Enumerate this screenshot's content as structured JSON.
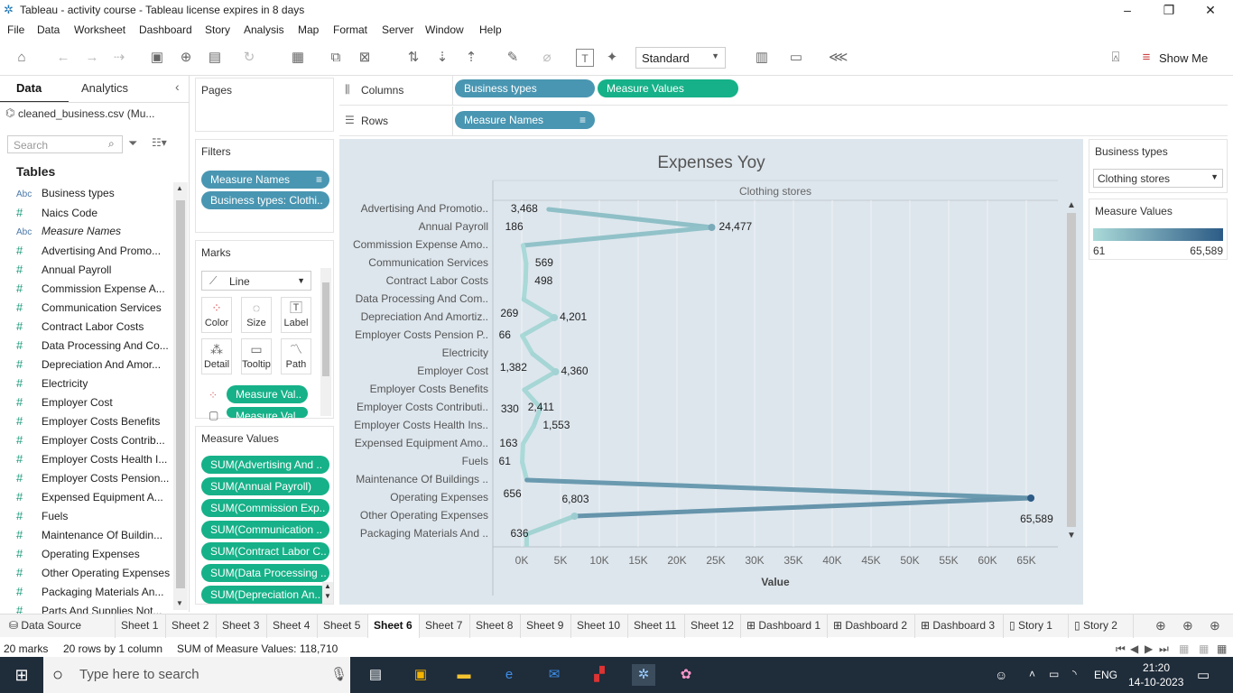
{
  "window": {
    "title": "Tableau - activity course - Tableau license expires in 8 days"
  },
  "menu": [
    "File",
    "Data",
    "Worksheet",
    "Dashboard",
    "Story",
    "Analysis",
    "Map",
    "Format",
    "Server",
    "Window",
    "Help"
  ],
  "toolbar": {
    "standard_label": "Standard",
    "show_me": "Show Me"
  },
  "datapane": {
    "tab_data": "Data",
    "tab_analytics": "Analytics",
    "datasource": "cleaned_business.csv (Mu...",
    "search_placeholder": "Search",
    "tables_heading": "Tables",
    "fields": [
      {
        "type": "Abc",
        "name": "Business types"
      },
      {
        "type": "#",
        "name": "Naics Code"
      },
      {
        "type": "Abc",
        "name": "Measure Names"
      },
      {
        "type": "#",
        "name": "Advertising And Promo..."
      },
      {
        "type": "#",
        "name": "Annual Payroll"
      },
      {
        "type": "#",
        "name": "Commission Expense A..."
      },
      {
        "type": "#",
        "name": "Communication Services"
      },
      {
        "type": "#",
        "name": "Contract Labor Costs"
      },
      {
        "type": "#",
        "name": "Data Processing And Co..."
      },
      {
        "type": "#",
        "name": "Depreciation And Amor..."
      },
      {
        "type": "#",
        "name": "Electricity"
      },
      {
        "type": "#",
        "name": "Employer Cost"
      },
      {
        "type": "#",
        "name": "Employer Costs Benefits"
      },
      {
        "type": "#",
        "name": "Employer Costs Contrib..."
      },
      {
        "type": "#",
        "name": "Employer Costs Health I..."
      },
      {
        "type": "#",
        "name": "Employer Costs Pension..."
      },
      {
        "type": "#",
        "name": "Expensed Equipment A..."
      },
      {
        "type": "#",
        "name": "Fuels"
      },
      {
        "type": "#",
        "name": "Maintenance Of Buildin..."
      },
      {
        "type": "#",
        "name": "Operating Expenses"
      },
      {
        "type": "#",
        "name": "Other Operating Expenses"
      },
      {
        "type": "#",
        "name": "Packaging Materials An..."
      },
      {
        "type": "#",
        "name": "Parts And Supplies Not..."
      }
    ]
  },
  "cards": {
    "pages": "Pages",
    "filters": "Filters",
    "filter_pills": [
      "Measure Names",
      "Business types: Clothi.."
    ],
    "marks": "Marks",
    "mark_type": "Line",
    "mark_buttons": [
      "Color",
      "Size",
      "Label",
      "Detail",
      "Tooltip",
      "Path"
    ],
    "mark_pills": [
      "Measure Val..",
      "Measure Val.."
    ],
    "measure_values": "Measure Values",
    "mv_pills": [
      "SUM(Advertising And ..",
      "SUM(Annual Payroll)",
      "SUM(Commission Exp..",
      "SUM(Communication ..",
      "SUM(Contract Labor C..",
      "SUM(Data Processing ..",
      "SUM(Depreciation An.."
    ]
  },
  "shelves": {
    "columns": "Columns",
    "rows": "Rows",
    "column_pills": [
      "Business types",
      "Measure Values"
    ],
    "row_pills": [
      "Measure Names"
    ]
  },
  "chart_data": {
    "type": "line",
    "title": "Expenses Yoy",
    "column_header": "Clothing stores",
    "xlabel": "Value",
    "xlim": [
      0,
      70000
    ],
    "xticks": [
      "0K",
      "5K",
      "10K",
      "15K",
      "20K",
      "25K",
      "30K",
      "35K",
      "40K",
      "45K",
      "50K",
      "55K",
      "60K",
      "65K"
    ],
    "categories": [
      "Advertising And Promotio..",
      "Annual Payroll",
      "Commission Expense Amo..",
      "Communication Services",
      "Contract Labor Costs",
      "Data Processing And Com..",
      "Depreciation And Amortiz..",
      "Employer Costs Pension P..",
      "Electricity",
      "Employer Cost",
      "Employer Costs Benefits",
      "Employer Costs Contributi..",
      "Employer Costs Health Ins..",
      "Expensed Equipment Amo..",
      "Fuels",
      "Maintenance Of Buildings ..",
      "Operating Expenses",
      "Other Operating Expenses",
      "Packaging Materials And .."
    ],
    "point_labels": [
      {
        "label": "3,468",
        "value": 3468
      },
      {
        "label": "24,477",
        "value": 24477
      },
      {
        "label": "186",
        "value": 186
      },
      {
        "label": "569",
        "value": 569
      },
      {
        "label": "498",
        "value": 498
      },
      {
        "label": "269",
        "value": 269
      },
      {
        "label": "4,201",
        "value": 4201
      },
      {
        "label": "66",
        "value": 66
      },
      {
        "label": "1,382",
        "value": 1382
      },
      {
        "label": "4,360",
        "value": 4360
      },
      {
        "label": "330",
        "value": 330
      },
      {
        "label": "2,411",
        "value": 2411
      },
      {
        "label": "1,553",
        "value": 1553
      },
      {
        "label": "163",
        "value": 163
      },
      {
        "label": "61",
        "value": 61
      },
      {
        "label": "656",
        "value": 656
      },
      {
        "label": "6,803",
        "value": 6803
      },
      {
        "label": "65,589",
        "value": 65589
      },
      {
        "label": "636",
        "value": 636
      }
    ],
    "path_points": [
      3468,
      24477,
      186,
      569,
      498,
      269,
      4201,
      66,
      1382,
      4360,
      330,
      2411,
      1553,
      163,
      61,
      656,
      65589,
      6803,
      636
    ],
    "color_range": [
      "#aadad8",
      "#2c5b86"
    ]
  },
  "legends": {
    "business_types_title": "Business types",
    "business_types_value": "Clothing stores",
    "measure_values_title": "Measure Values",
    "min": "61",
    "max": "65,589"
  },
  "sheet_tabs": [
    "Data Source",
    "Sheet 1",
    "Sheet 2",
    "Sheet 3",
    "Sheet 4",
    "Sheet 5",
    "Sheet 6",
    "Sheet 7",
    "Sheet 8",
    "Sheet 9",
    "Sheet 10",
    "Sheet 11",
    "Sheet 12",
    "Dashboard 1",
    "Dashboard 2",
    "Dashboard 3",
    "Story 1",
    "Story 2"
  ],
  "active_sheet": "Sheet 6",
  "status": {
    "marks": "20 marks",
    "rows": "20 rows by 1 column",
    "sum": "SUM of Measure Values: 118,710"
  },
  "taskbar": {
    "search_placeholder": "Type here to search",
    "lang": "ENG",
    "time": "21:20",
    "date": "14-10-2023"
  }
}
